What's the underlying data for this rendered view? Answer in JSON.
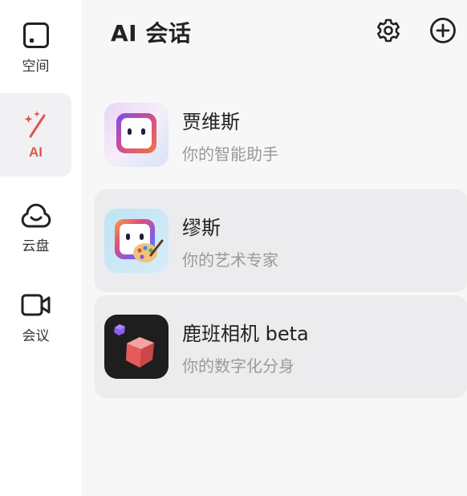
{
  "sidebar": {
    "items": [
      {
        "label": "空间",
        "icon": "square-dot-icon",
        "active": false
      },
      {
        "label": "AI",
        "icon": "magic-wand-icon",
        "active": true
      },
      {
        "label": "云盘",
        "icon": "cloud-icon",
        "active": false
      },
      {
        "label": "会议",
        "icon": "video-camera-icon",
        "active": false
      }
    ]
  },
  "header": {
    "title": "AI 会话",
    "settings_icon": "gear-icon",
    "add_icon": "plus-circle-icon"
  },
  "bots": [
    {
      "name": "贾维斯",
      "desc": "你的智能助手",
      "avatar": "robot-face-avatar"
    },
    {
      "name": "缪斯",
      "desc": "你的艺术专家",
      "avatar": "robot-palette-avatar"
    },
    {
      "name": "鹿班相机 beta",
      "desc": "你的数字化分身",
      "avatar": "cube-avatar"
    }
  ],
  "colors": {
    "accent": "#e4554c",
    "rail_active_bg": "#f1f1f3",
    "main_bg": "#f7f7f8",
    "row_hover_bg": "#ececee"
  }
}
